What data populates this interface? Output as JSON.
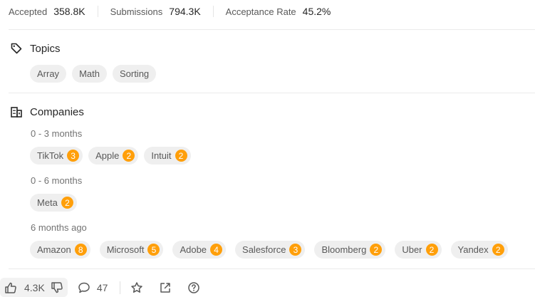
{
  "stats": {
    "accepted_label": "Accepted",
    "accepted_value": "358.8K",
    "submissions_label": "Submissions",
    "submissions_value": "794.3K",
    "rate_label": "Acceptance Rate",
    "rate_value": "45.2%"
  },
  "topics": {
    "title": "Topics",
    "icon": "tag-icon",
    "items": [
      "Array",
      "Math",
      "Sorting"
    ]
  },
  "companies": {
    "title": "Companies",
    "icon": "building-icon",
    "groups": [
      {
        "period": "0 - 3 months",
        "items": [
          {
            "name": "TikTok",
            "count": "3"
          },
          {
            "name": "Apple",
            "count": "2"
          },
          {
            "name": "Intuit",
            "count": "2"
          }
        ]
      },
      {
        "period": "0 - 6 months",
        "items": [
          {
            "name": "Meta",
            "count": "2"
          }
        ]
      },
      {
        "period": "6 months ago",
        "items": [
          {
            "name": "Amazon",
            "count": "8"
          },
          {
            "name": "Microsoft",
            "count": "5"
          },
          {
            "name": "Adobe",
            "count": "4"
          },
          {
            "name": "Salesforce",
            "count": "3"
          },
          {
            "name": "Bloomberg",
            "count": "2"
          },
          {
            "name": "Uber",
            "count": "2"
          },
          {
            "name": "Yandex",
            "count": "2"
          }
        ]
      }
    ]
  },
  "bottombar": {
    "likes": "4.3K",
    "comments": "47",
    "icons": [
      "thumbs-up-icon",
      "thumbs-down-icon",
      "comment-icon",
      "star-icon",
      "share-icon",
      "help-icon"
    ]
  },
  "colors": {
    "badge": "#ff9f0a",
    "chip_bg": "#efefef",
    "text": "#262626",
    "muted": "#595959"
  }
}
